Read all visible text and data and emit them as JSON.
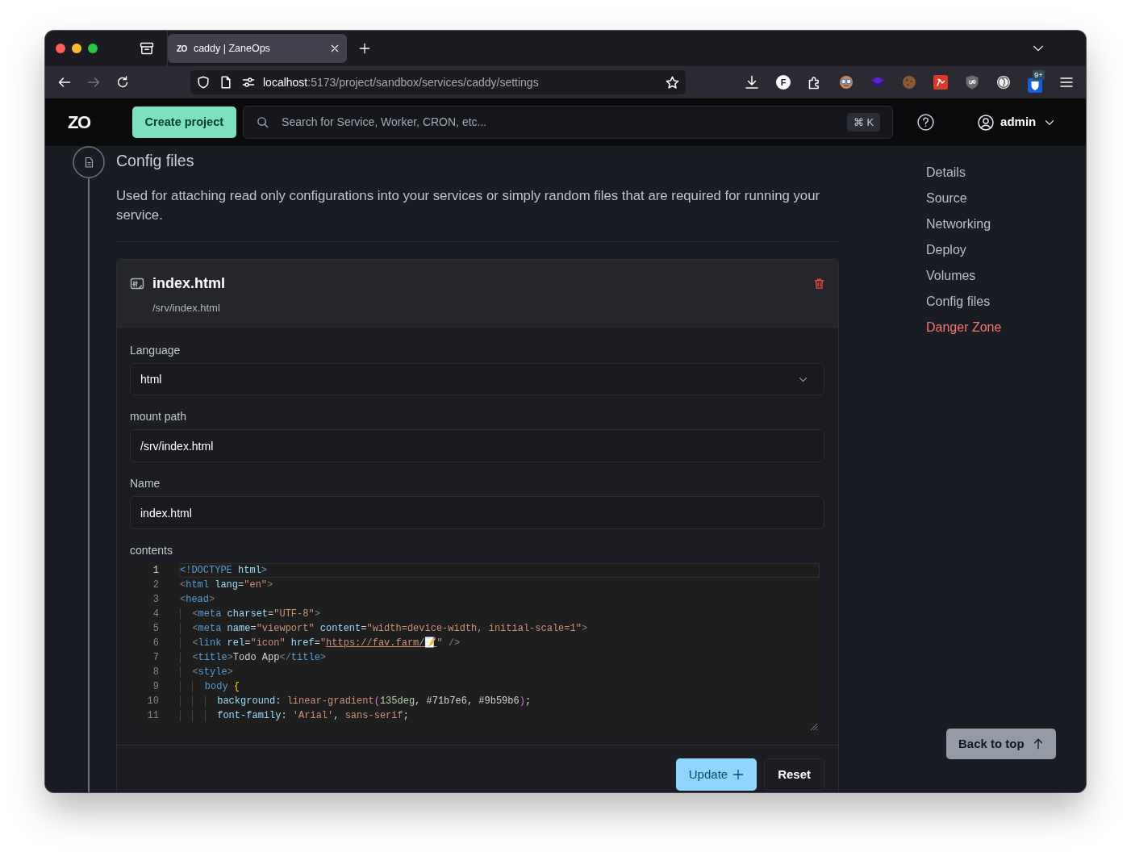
{
  "browser": {
    "tab": {
      "favicon": "ZO",
      "title": "caddy | ZaneOps",
      "selected": true
    },
    "nav_buttons": [
      {
        "kind": "back",
        "disabled": false
      },
      {
        "kind": "forward",
        "disabled": true
      },
      {
        "kind": "reload",
        "disabled": false
      }
    ],
    "address_bar": {
      "host": "localhost",
      "path": ":5173/project/sandbox/services/caddy/settings"
    },
    "extension_letter": "F",
    "extension_badge": "9+"
  },
  "header": {
    "logo": "ZO",
    "create_button": "Create project",
    "search": {
      "placeholder": "Search for Service, Worker, CRON, etc...",
      "shortcut": "⌘ K"
    },
    "user": "admin"
  },
  "section": {
    "title": "Config files",
    "description": "Used for attaching read only configurations into your services or simply random files that are required for running your service."
  },
  "config_file": {
    "name": "index.html",
    "path": "/srv/index.html",
    "fields": [
      {
        "kind": "select",
        "label": "Language",
        "value": "html"
      },
      {
        "kind": "input",
        "label": "mount path",
        "value": "/srv/index.html"
      },
      {
        "kind": "input",
        "label": "Name",
        "value": "index.html"
      }
    ],
    "contents_label": "contents",
    "code_lines": [
      {
        "number": "1",
        "active": true,
        "tokens": [
          {
            "kind": "keyword",
            "text": "<!DOCTYPE"
          },
          {
            "kind": "attr",
            "text": " html"
          },
          {
            "kind": "keyword",
            "text": ">"
          }
        ]
      },
      {
        "number": "2",
        "active": false,
        "tokens": [
          {
            "kind": "delim",
            "text": "<"
          },
          {
            "kind": "keyword",
            "text": "html"
          },
          {
            "kind": "attr",
            "text": " lang"
          },
          {
            "kind": "plain",
            "text": "="
          },
          {
            "kind": "string",
            "text": "\"en\""
          },
          {
            "kind": "delim",
            "text": ">"
          }
        ]
      },
      {
        "number": "3",
        "active": false,
        "tokens": [
          {
            "kind": "delim",
            "text": "<"
          },
          {
            "kind": "keyword",
            "text": "head"
          },
          {
            "kind": "delim",
            "text": ">"
          }
        ]
      },
      {
        "number": "4",
        "active": false,
        "tokens": [
          {
            "kind": "delim",
            "text": "  <"
          },
          {
            "kind": "keyword",
            "text": "meta"
          },
          {
            "kind": "attr",
            "text": " charset"
          },
          {
            "kind": "plain",
            "text": "="
          },
          {
            "kind": "string",
            "text": "\"UTF-8\""
          },
          {
            "kind": "delim",
            "text": ">"
          }
        ]
      },
      {
        "number": "5",
        "active": false,
        "tokens": [
          {
            "kind": "delim",
            "text": "  <"
          },
          {
            "kind": "keyword",
            "text": "meta"
          },
          {
            "kind": "attr",
            "text": " name"
          },
          {
            "kind": "plain",
            "text": "="
          },
          {
            "kind": "string",
            "text": "\"viewport\""
          },
          {
            "kind": "attr",
            "text": " content"
          },
          {
            "kind": "plain",
            "text": "="
          },
          {
            "kind": "string",
            "text": "\"width=device-width, initial-scale=1\""
          },
          {
            "kind": "delim",
            "text": ">"
          }
        ]
      },
      {
        "number": "6",
        "active": false,
        "tokens": [
          {
            "kind": "delim",
            "text": "  <"
          },
          {
            "kind": "keyword",
            "text": "link"
          },
          {
            "kind": "attr",
            "text": " rel"
          },
          {
            "kind": "plain",
            "text": "="
          },
          {
            "kind": "string",
            "text": "\"icon\""
          },
          {
            "kind": "attr",
            "text": " href"
          },
          {
            "kind": "plain",
            "text": "="
          },
          {
            "kind": "string",
            "text": "\""
          },
          {
            "kind": "link",
            "text": "https://fav.farm/📝"
          },
          {
            "kind": "string",
            "text": "\""
          },
          {
            "kind": "delim",
            "text": " />"
          }
        ]
      },
      {
        "number": "7",
        "active": false,
        "tokens": [
          {
            "kind": "delim",
            "text": "  <"
          },
          {
            "kind": "keyword",
            "text": "title"
          },
          {
            "kind": "delim",
            "text": ">"
          },
          {
            "kind": "plain",
            "text": "Todo App"
          },
          {
            "kind": "delim",
            "text": "</"
          },
          {
            "kind": "keyword",
            "text": "title"
          },
          {
            "kind": "delim",
            "text": ">"
          }
        ]
      },
      {
        "number": "8",
        "active": false,
        "tokens": [
          {
            "kind": "delim",
            "text": "  <"
          },
          {
            "kind": "keyword",
            "text": "style"
          },
          {
            "kind": "delim",
            "text": ">"
          }
        ]
      },
      {
        "number": "9",
        "active": false,
        "tokens": [
          {
            "kind": "keyword",
            "text": "    body"
          },
          {
            "kind": "brace",
            "text": " {"
          }
        ]
      },
      {
        "number": "10",
        "active": false,
        "tokens": [
          {
            "kind": "attr",
            "text": "      background"
          },
          {
            "kind": "plain",
            "text": ": "
          },
          {
            "kind": "string",
            "text": "linear-gradient"
          },
          {
            "kind": "paren",
            "text": "("
          },
          {
            "kind": "number",
            "text": "135deg"
          },
          {
            "kind": "plain",
            "text": ", #71b7e6, #9b59b6"
          },
          {
            "kind": "paren",
            "text": ")"
          },
          {
            "kind": "plain",
            "text": ";"
          }
        ]
      },
      {
        "number": "11",
        "active": false,
        "tokens": [
          {
            "kind": "attr",
            "text": "      font-family"
          },
          {
            "kind": "plain",
            "text": ": "
          },
          {
            "kind": "string",
            "text": "'Arial'"
          },
          {
            "kind": "plain",
            "text": ", "
          },
          {
            "kind": "string",
            "text": "sans-serif"
          },
          {
            "kind": "plain",
            "text": ";"
          }
        ]
      }
    ],
    "buttons": [
      {
        "kind": "primary",
        "label": "Update"
      },
      {
        "kind": "secondary",
        "label": "Reset"
      }
    ]
  },
  "nav": [
    {
      "kind": "link",
      "label": "Details"
    },
    {
      "kind": "link",
      "label": "Source"
    },
    {
      "kind": "link",
      "label": "Networking"
    },
    {
      "kind": "link",
      "label": "Deploy"
    },
    {
      "kind": "link",
      "label": "Volumes"
    },
    {
      "kind": "link",
      "label": "Config files"
    },
    {
      "kind": "danger",
      "label": "Danger Zone"
    }
  ],
  "back_to_top": "Back to top"
}
